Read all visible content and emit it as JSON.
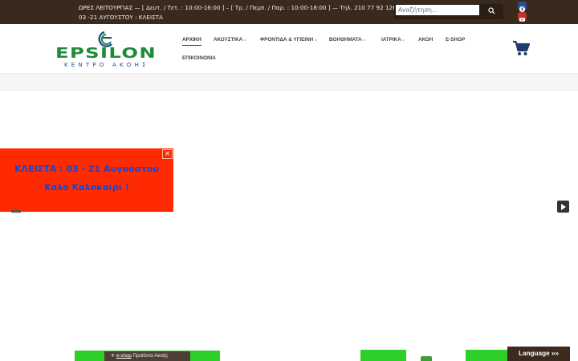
{
  "topbar": {
    "hours_line1": "ΩΡΕΣ ΛΕΙΤΟΥΡΓΙΑΣ — [ Δευτ. / Τετ. : 10:00-16:00 ] – [ Τρ. / Πεμπ. / Παρ. : 10:00-18:00 ] — Τηλ. 210 77 92 126",
    "hours_line2": "03 -21 ΑΥΓΟΥΣΤΟΥ : ΚΛΕΙΣΤΑ",
    "search_placeholder": "Αναζήτηση…",
    "social": [
      "facebook-icon",
      "youtube-icon"
    ]
  },
  "logo": {
    "brand": "EPSILON",
    "tagline": "ΚΕΝΤΡΟ ΑΚΟΗΣ"
  },
  "nav": {
    "items": [
      {
        "label": "ΑΡΧΙΚΗ",
        "active": true,
        "dropdown": false
      },
      {
        "label": "ΑΚΟΥΣΤΙΚΑ",
        "active": false,
        "dropdown": true
      },
      {
        "label": "ΦΡΟΝΤΙΔΑ & ΥΓΙΕΙΝΗ",
        "active": false,
        "dropdown": true
      },
      {
        "label": "ΒΟΗΘΗΜΑΤΑ",
        "active": false,
        "dropdown": true
      },
      {
        "label": "ΙΑΤΡΙΚΑ",
        "active": false,
        "dropdown": true
      },
      {
        "label": "ΑΚΟΗ",
        "active": false,
        "dropdown": false
      },
      {
        "label": "E-SHOP",
        "active": false,
        "dropdown": false
      },
      {
        "label": "ΕΠΙΚΟΙΝΩΝΙΑ",
        "active": false,
        "dropdown": false
      }
    ],
    "chevron": "⌵"
  },
  "popup": {
    "line1": "ΚΛΕΙΣΤΑ : 03 - 21 Αυγούστου",
    "line2": "Καλό Καλοκαίρι !",
    "close": "×"
  },
  "footer_bar": {
    "eshop_link": "e-shop",
    "eshop_text": " Προϊόντα Ακοής"
  },
  "language_button": "Language »»",
  "colors": {
    "topbar": "#3a2a1e",
    "logo_green": "#1f8a3a",
    "logo_blue": "#1b4f8f",
    "popup_bg": "#ff2a00",
    "popup_text": "#1246d8",
    "accent_green": "#2fcf2a"
  }
}
